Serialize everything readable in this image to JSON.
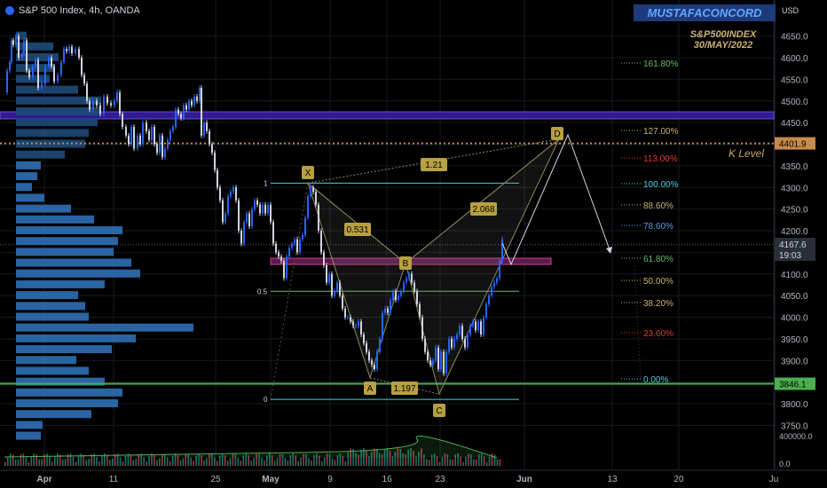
{
  "header": {
    "symbol_line": "S&P 500 Index, 4h, OANDA"
  },
  "brand": "MUSTAFACONCORD",
  "currency": "USD",
  "subtitle": [
    "S&P500INDEX",
    "30/MAY/2022"
  ],
  "k_level_label": "K Level",
  "colors": {
    "bg": "#000000",
    "up": "#2962ff",
    "down": "#d1d4dc",
    "profile": "#2f6fb5",
    "k_level": "#c78a4a",
    "green_line": "#4caf50",
    "band": "#311b92"
  },
  "chart_data": {
    "type": "candlestick",
    "timeframe": "4h",
    "ylim": [
      3750,
      4700
    ],
    "y_ticks": [
      3750,
      3800,
      3850,
      3900,
      3950,
      4000,
      4050,
      4100,
      4150,
      4200,
      4250,
      4300,
      4350,
      4400,
      4450,
      4500,
      4550,
      4600,
      4650
    ],
    "x_ticks": [
      "Apr",
      "11",
      "25",
      "May",
      "9",
      "16",
      "23",
      "Jun",
      "13",
      "20",
      "Ju"
    ],
    "price_path": [
      [
        0,
        4520
      ],
      [
        3,
        4570
      ],
      [
        6,
        4590
      ],
      [
        8,
        4640
      ],
      [
        10,
        4630
      ],
      [
        13,
        4650
      ],
      [
        16,
        4600
      ],
      [
        20,
        4610
      ],
      [
        22,
        4640
      ],
      [
        25,
        4570
      ],
      [
        28,
        4555
      ],
      [
        32,
        4580
      ],
      [
        35,
        4595
      ],
      [
        38,
        4530
      ],
      [
        42,
        4540
      ],
      [
        46,
        4580
      ],
      [
        50,
        4600
      ],
      [
        53,
        4580
      ],
      [
        56,
        4545
      ],
      [
        60,
        4560
      ],
      [
        64,
        4590
      ],
      [
        67,
        4620
      ],
      [
        70,
        4615
      ],
      [
        73,
        4625
      ],
      [
        76,
        4610
      ],
      [
        80,
        4620
      ],
      [
        84,
        4600
      ],
      [
        87,
        4560
      ],
      [
        90,
        4540
      ],
      [
        93,
        4500
      ],
      [
        96,
        4480
      ],
      [
        100,
        4500
      ],
      [
        104,
        4490
      ],
      [
        108,
        4470
      ],
      [
        112,
        4510
      ],
      [
        116,
        4495
      ],
      [
        120,
        4490
      ],
      [
        124,
        4500
      ],
      [
        127,
        4520
      ],
      [
        130,
        4470
      ],
      [
        133,
        4440
      ],
      [
        137,
        4420
      ],
      [
        140,
        4400
      ],
      [
        143,
        4440
      ],
      [
        146,
        4390
      ],
      [
        150,
        4420
      ],
      [
        153,
        4400
      ],
      [
        156,
        4450
      ],
      [
        160,
        4430
      ],
      [
        163,
        4410
      ],
      [
        166,
        4440
      ],
      [
        169,
        4400
      ],
      [
        172,
        4380
      ],
      [
        175,
        4420
      ],
      [
        178,
        4370
      ],
      [
        181,
        4390
      ],
      [
        184,
        4410
      ],
      [
        187,
        4430
      ],
      [
        190,
        4440
      ],
      [
        193,
        4480
      ],
      [
        196,
        4470
      ],
      [
        199,
        4460
      ],
      [
        202,
        4490
      ],
      [
        205,
        4480
      ],
      [
        208,
        4500
      ],
      [
        211,
        4490
      ],
      [
        214,
        4510
      ],
      [
        217,
        4500
      ],
      [
        220,
        4530
      ],
      [
        222,
        4420
      ],
      [
        225,
        4450
      ],
      [
        228,
        4430
      ],
      [
        231,
        4400
      ],
      [
        234,
        4380
      ],
      [
        237,
        4340
      ],
      [
        240,
        4300
      ],
      [
        243,
        4270
      ],
      [
        246,
        4220
      ],
      [
        249,
        4240
      ],
      [
        252,
        4280
      ],
      [
        255,
        4290
      ],
      [
        258,
        4300
      ],
      [
        261,
        4270
      ],
      [
        264,
        4200
      ],
      [
        267,
        4170
      ],
      [
        270,
        4220
      ],
      [
        273,
        4240
      ],
      [
        276,
        4210
      ],
      [
        279,
        4250
      ],
      [
        282,
        4270
      ],
      [
        285,
        4260
      ],
      [
        288,
        4240
      ],
      [
        291,
        4260
      ],
      [
        294,
        4240
      ],
      [
        297,
        4260
      ],
      [
        300,
        4220
      ],
      [
        303,
        4170
      ],
      [
        306,
        4150
      ],
      [
        309,
        4140
      ],
      [
        312,
        4130
      ],
      [
        315,
        4090
      ],
      [
        318,
        4140
      ],
      [
        321,
        4160
      ],
      [
        324,
        4170
      ],
      [
        327,
        4180
      ],
      [
        330,
        4150
      ],
      [
        333,
        4180
      ],
      [
        336,
        4190
      ],
      [
        339,
        4230
      ],
      [
        342,
        4280
      ],
      [
        345,
        4300
      ],
      [
        348,
        4290
      ],
      [
        351,
        4260
      ],
      [
        354,
        4200
      ],
      [
        357,
        4150
      ],
      [
        360,
        4120
      ],
      [
        363,
        4080
      ],
      [
        366,
        4100
      ],
      [
        369,
        4050
      ],
      [
        372,
        4060
      ],
      [
        375,
        4080
      ],
      [
        378,
        4050
      ],
      [
        381,
        4020
      ],
      [
        384,
        4000
      ],
      [
        387,
        4000
      ],
      [
        390,
        3990
      ],
      [
        393,
        3980
      ],
      [
        396,
        3980
      ],
      [
        399,
        3990
      ],
      [
        402,
        3960
      ],
      [
        405,
        3940
      ],
      [
        408,
        3920
      ],
      [
        411,
        3900
      ],
      [
        414,
        3890
      ],
      [
        417,
        3880
      ],
      [
        420,
        3920
      ],
      [
        423,
        3950
      ],
      [
        426,
        4010
      ],
      [
        429,
        4020
      ],
      [
        432,
        4010
      ],
      [
        435,
        4040
      ],
      [
        438,
        4060
      ],
      [
        441,
        4040
      ],
      [
        444,
        4050
      ],
      [
        447,
        4060
      ],
      [
        450,
        4080
      ],
      [
        453,
        4090
      ],
      [
        456,
        4100
      ],
      [
        459,
        4080
      ],
      [
        462,
        4060
      ],
      [
        465,
        4030
      ],
      [
        468,
        4000
      ],
      [
        471,
        3950
      ],
      [
        474,
        3920
      ],
      [
        477,
        3900
      ],
      [
        480,
        3890
      ],
      [
        483,
        3900
      ],
      [
        486,
        3930
      ],
      [
        489,
        3880
      ],
      [
        492,
        3920
      ],
      [
        495,
        3870
      ],
      [
        498,
        3920
      ],
      [
        501,
        3950
      ],
      [
        504,
        3930
      ],
      [
        507,
        3950
      ],
      [
        510,
        3960
      ],
      [
        513,
        3980
      ],
      [
        516,
        3950
      ],
      [
        519,
        3930
      ],
      [
        522,
        3960
      ],
      [
        525,
        3980
      ],
      [
        528,
        3990
      ],
      [
        531,
        3970
      ],
      [
        534,
        3990
      ],
      [
        537,
        3960
      ],
      [
        540,
        4000
      ],
      [
        543,
        4030
      ],
      [
        546,
        4050
      ],
      [
        549,
        4070
      ],
      [
        552,
        4080
      ],
      [
        555,
        4090
      ],
      [
        558,
        4130
      ],
      [
        561,
        4180
      ]
    ],
    "volume_profile": [
      [
        "4650",
        12
      ],
      [
        "4625",
        42
      ],
      [
        "4600",
        48
      ],
      [
        "4575",
        44
      ],
      [
        "4550",
        38
      ],
      [
        "4525",
        70
      ],
      [
        "4500",
        96
      ],
      [
        "4475",
        96
      ],
      [
        "4450",
        92
      ],
      [
        "4425",
        82
      ],
      [
        "4400",
        78
      ],
      [
        "4375",
        55
      ],
      [
        "4350",
        28
      ],
      [
        "4325",
        24
      ],
      [
        "4300",
        18
      ],
      [
        "4275",
        32
      ],
      [
        "4250",
        62
      ],
      [
        "4225",
        88
      ],
      [
        "4200",
        120
      ],
      [
        "4175",
        115
      ],
      [
        "4150",
        110
      ],
      [
        "4125",
        130
      ],
      [
        "4100",
        140
      ],
      [
        "4075",
        100
      ],
      [
        "4050",
        70
      ],
      [
        "4025",
        78
      ],
      [
        "4000",
        82
      ],
      [
        "3975",
        200
      ],
      [
        "3950",
        135
      ],
      [
        "3925",
        108
      ],
      [
        "3900",
        68
      ],
      [
        "3875",
        82
      ],
      [
        "3850",
        100
      ],
      [
        "3825",
        120
      ],
      [
        "3800",
        115
      ],
      [
        "3775",
        85
      ],
      [
        "3750",
        30
      ],
      [
        "3725",
        28
      ]
    ],
    "horizontal_lines": {
      "k_level": 4401.9,
      "green_line": 3846.1,
      "current_price": 4167.6
    },
    "fib_levels": [
      {
        "label": "161.80%",
        "price": 4590
      },
      {
        "label": "127.00%",
        "price": 4420
      },
      {
        "label": "113.00%",
        "price": 4355
      },
      {
        "label": "100.00%",
        "price": 4290
      },
      {
        "label": "88.60%",
        "price": 4235
      },
      {
        "label": "78.60%",
        "price": 4180
      },
      {
        "label": "61.80%",
        "price": 4095
      },
      {
        "label": "50.00%",
        "price": 4040
      },
      {
        "label": "38.20%",
        "price": 3980
      },
      {
        "label": "23.60%",
        "price": 3905
      },
      {
        "label": "0.00%",
        "price": 3790
      }
    ],
    "fib_anchor_labels": [
      "1",
      "0.5",
      "0"
    ],
    "pattern_points": [
      {
        "label": "X",
        "price": 4310
      },
      {
        "label": "A",
        "price": 3860
      },
      {
        "label": "B",
        "price": 4120
      },
      {
        "label": "C",
        "price": 3825
      },
      {
        "label": "D",
        "price": 4420
      }
    ],
    "ratio_labels": [
      {
        "label": "0.531"
      },
      {
        "label": "1.197"
      },
      {
        "label": "2.068"
      },
      {
        "label": "1.21"
      }
    ],
    "price_badges": [
      "4401.9",
      "4167.6",
      "19:03",
      "3846.1"
    ],
    "volume_axis_labels": [
      "400000.0",
      "0.0"
    ]
  }
}
